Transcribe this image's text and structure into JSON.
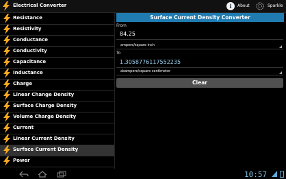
{
  "app": {
    "title": "Electrical Converter"
  },
  "actions": {
    "about": "About",
    "sparkle": "Sparkle"
  },
  "sidebar": {
    "items": [
      {
        "label": "Resistance"
      },
      {
        "label": "Resistivity"
      },
      {
        "label": "Conductance"
      },
      {
        "label": "Conductivity"
      },
      {
        "label": "Capacitance"
      },
      {
        "label": "Inductance"
      },
      {
        "label": "Charge"
      },
      {
        "label": "Linear Change Density"
      },
      {
        "label": "Surface Charge Density"
      },
      {
        "label": "Volume Charge Density"
      },
      {
        "label": "Current"
      },
      {
        "label": "Linear Current Density"
      },
      {
        "label": "Surface Current Density"
      },
      {
        "label": "Power"
      }
    ],
    "selected_index": 12
  },
  "converter": {
    "title": "Surface Current Density Converter",
    "from_label": "From",
    "from_value": "84.25",
    "from_unit": "ampere/square inch",
    "to_label": "To",
    "to_value": "1.3058776117552235",
    "to_unit": "abampere/square centimeter",
    "clear_label": "Clear"
  },
  "statusbar": {
    "time": "10:57"
  },
  "colors": {
    "accent": "#1f7bb0",
    "bolt": "#f7a81e",
    "clock": "#7fbfe4"
  }
}
